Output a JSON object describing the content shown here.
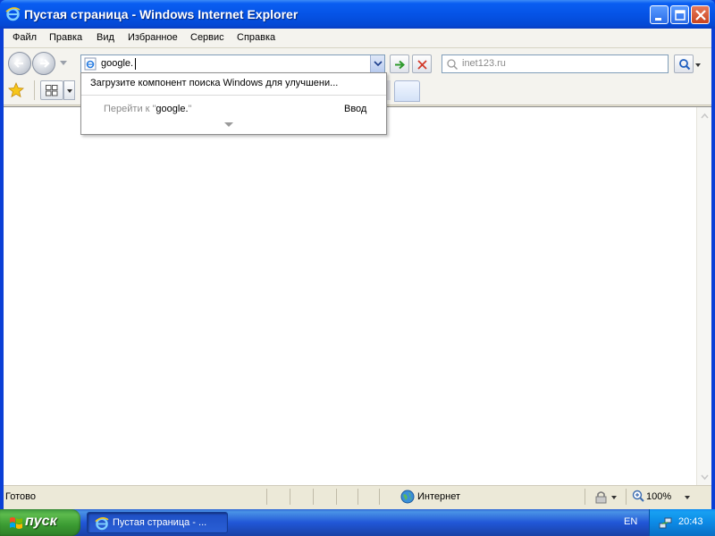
{
  "window": {
    "title": "Пустая страница - Windows Internet Explorer",
    "accent": "#0553e6"
  },
  "menu": {
    "items": [
      {
        "label": "Файл"
      },
      {
        "label": "Правка"
      },
      {
        "label": "Вид"
      },
      {
        "label": "Избранное"
      },
      {
        "label": "Сервис"
      },
      {
        "label": "Справка"
      }
    ]
  },
  "address": {
    "value": "google.",
    "icon": "ie-page-icon"
  },
  "search": {
    "placeholder": "inet123.ru"
  },
  "suggest": {
    "addon_text": "Загрузите компонент поиска Windows для улучшени...",
    "go_prefix": "Перейти к \"",
    "go_target": "google.",
    "go_suffix": "\"",
    "enter_label": "Ввод"
  },
  "status": {
    "text": "Готово",
    "zone": "Интернет",
    "zoom": "100%"
  },
  "taskbar": {
    "start_label": "пуск",
    "task_label": "Пустая страница - ...",
    "language": "EN",
    "clock": "20:43"
  }
}
